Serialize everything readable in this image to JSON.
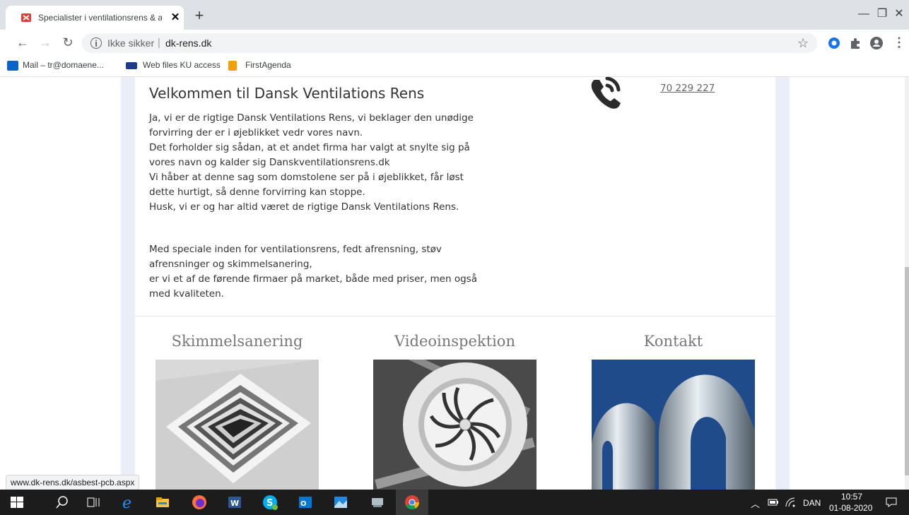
{
  "browser": {
    "tab_title": "Specialister i ventilationsrens & a",
    "tab_close": "✕",
    "new_tab": "+",
    "insecure_label": "Ikke sikker",
    "separator": "|",
    "url": "dk-rens.dk",
    "window": {
      "minimize": "—",
      "maximize": "❐",
      "close": "✕"
    },
    "bookmarks": [
      {
        "label": "Mail – tr@domaene...",
        "icon": "outlook-icon"
      },
      {
        "label": "Web files KU access",
        "icon": "ku-icon"
      },
      {
        "label": "FirstAgenda",
        "icon": "firstagenda-icon"
      }
    ]
  },
  "page": {
    "heading": "Velkommen til Dansk Ventilations Rens",
    "intro_lines": [
      "Ja, vi er de rigtige Dansk Ventilations Rens, vi beklager den unødige",
      "forvirring der er i øjeblikket vedr vores navn.",
      "Det forholder sig sådan, at et andet firma har valgt at snylte sig på",
      "vores navn og kalder sig Danskventilationsrens.dk",
      "Vi håber at denne sag som domstolene ser på i øjeblikket, får løst",
      "dette hurtigt, så denne forvirring kan stoppe.",
      "Husk, vi er og har altid været de rigtige Dansk Ventilations Rens."
    ],
    "specialty_lines": [
      "Med speciale inden for ventilationsrens, fedt afrensning, støv",
      "afrensninger og skimmelsanering,",
      "er vi et af de førende firmaer på market, både med priser, men også",
      "med kvaliteten."
    ],
    "phone": "70 229 227",
    "cards": [
      {
        "title": "Skimmelsanering"
      },
      {
        "title": "Videoinspektion"
      },
      {
        "title": "Kontakt"
      }
    ]
  },
  "status_url": "www.dk-rens.dk/asbest-pcb.aspx",
  "taskbar": {
    "language": "DAN",
    "time": "10:57",
    "date": "01-08-2020"
  },
  "colors": {
    "accent_band": "#e9eef9",
    "taskbar": "#1c1c1c",
    "tab_strip": "#dee1e6"
  }
}
